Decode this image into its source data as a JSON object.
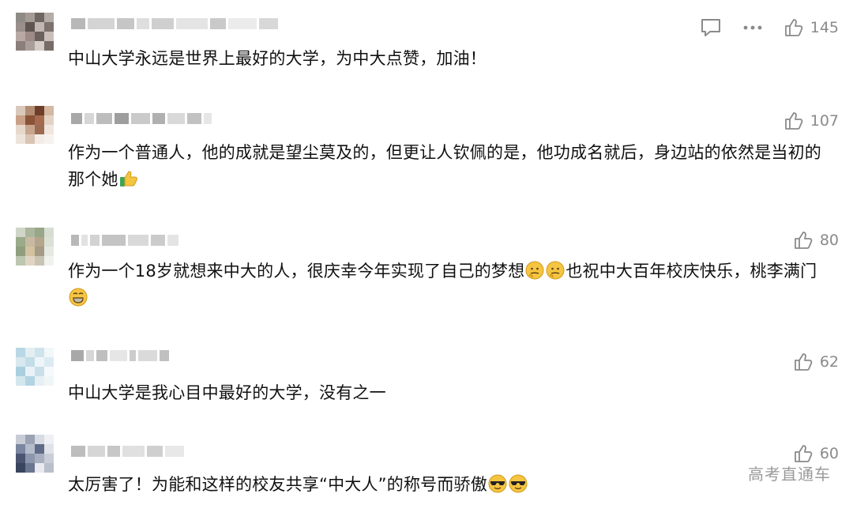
{
  "comments": [
    {
      "text": "中山大学永远是世界上最好的大学，为中大点赞，加油！",
      "likes": "145",
      "has_reply_icon": true,
      "has_more_icon": true
    },
    {
      "text_parts": [
        "作为一个普通人，他的成就是望尘莫及的，但更让人钦佩的是，他功成名就后，身边站的依然是当初的那个她"
      ],
      "emojis": [
        "thumbs-up"
      ],
      "likes": "107"
    },
    {
      "text_parts": [
        "作为一个18岁就想来中大的人，很庆幸今年实现了自己的梦想",
        "也祝中大百年校庆快乐，桃李满门"
      ],
      "emojis": [
        "thinking-face",
        "thinking-face",
        "grinning-face"
      ],
      "likes": "80"
    },
    {
      "text": "中山大学是我心目中最好的大学，没有之一",
      "likes": "62"
    },
    {
      "text_parts": [
        "太厉害了！为能和这样的校友共享“中大人”的称号而骄傲"
      ],
      "emojis": [
        "sunglasses-face",
        "sunglasses-face"
      ],
      "likes": "60"
    }
  ],
  "watermark": "高考直通车",
  "icons": {
    "reply": "comment-bubble-icon",
    "more": "more-dots-icon",
    "like": "thumbs-up-icon"
  },
  "colors": {
    "text": "#111111",
    "meta": "#8a8a8a",
    "emoji_yellow": "#f5c542",
    "emoji_green": "#3aa757"
  }
}
